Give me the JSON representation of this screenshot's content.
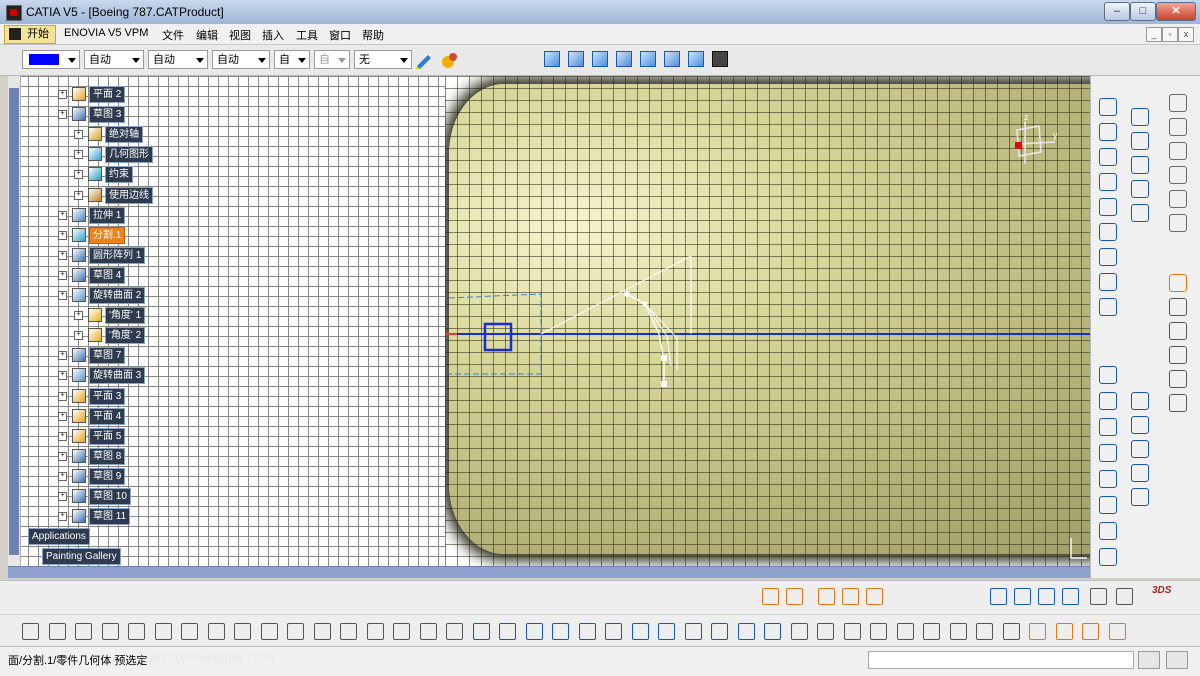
{
  "window": {
    "title": "CATIA V5 - [Boeing 787.CATProduct]"
  },
  "menu": {
    "start_label": "开始",
    "items": [
      {
        "id": "enovia",
        "label": "ENOVIA V5 VPM"
      },
      {
        "id": "file",
        "label": "文件"
      },
      {
        "id": "edit",
        "label": "编辑"
      },
      {
        "id": "view",
        "label": "视图"
      },
      {
        "id": "insert",
        "label": "插入"
      },
      {
        "id": "tools",
        "label": "工具"
      },
      {
        "id": "window",
        "label": "窗口"
      },
      {
        "id": "help",
        "label": "帮助"
      }
    ]
  },
  "graphic_props": {
    "color": "#0000ff",
    "combos": [
      "自动",
      "自动",
      "自动",
      "自动",
      "自动",
      "无"
    ],
    "combo_truncated": [
      "自动",
      "自动",
      "自动",
      "自动",
      "自",
      "自"
    ]
  },
  "tree": {
    "nodes": [
      {
        "label": "平面 2",
        "icon": "plane-icon",
        "level": 2,
        "selected": false
      },
      {
        "label": "草图 3",
        "icon": "sketch-icon",
        "level": 2,
        "selected": false
      },
      {
        "label": "绝对轴",
        "icon": "axis-system-icon",
        "level": 3,
        "selected": false
      },
      {
        "label": "几何图形",
        "icon": "geometry-icon",
        "level": 3,
        "selected": false
      },
      {
        "label": "约束",
        "icon": "constraint-icon",
        "level": 3,
        "selected": false
      },
      {
        "label": "使用边线",
        "icon": "use-edge-icon",
        "level": 3,
        "selected": false
      },
      {
        "label": "拉伸 1",
        "icon": "extrude-icon",
        "level": 2,
        "selected": false
      },
      {
        "label": "分割.1",
        "icon": "split-icon",
        "level": 2,
        "selected": true
      },
      {
        "label": "圆形阵列 1",
        "icon": "circular-pattern-icon",
        "level": 2,
        "selected": false
      },
      {
        "label": "草图 4",
        "icon": "sketch-icon",
        "level": 2,
        "selected": false
      },
      {
        "label": "旋转曲面 2",
        "icon": "revolve-surface-icon",
        "level": 2,
        "selected": false
      },
      {
        "label": "'角度' 1",
        "icon": "parameter-icon",
        "level": 3,
        "selected": false
      },
      {
        "label": "'角度' 2",
        "icon": "parameter-icon",
        "level": 3,
        "selected": false
      },
      {
        "label": "草图 7",
        "icon": "sketch-icon",
        "level": 2,
        "selected": false
      },
      {
        "label": "旋转曲面 3",
        "icon": "revolve-surface-icon",
        "level": 2,
        "selected": false
      },
      {
        "label": "平面 3",
        "icon": "plane-icon",
        "level": 2,
        "selected": false
      },
      {
        "label": "平面 4",
        "icon": "plane-icon",
        "level": 2,
        "selected": false
      },
      {
        "label": "平面 5",
        "icon": "plane-icon",
        "level": 2,
        "selected": false
      },
      {
        "label": "草图 8",
        "icon": "sketch-icon",
        "level": 2,
        "selected": false
      },
      {
        "label": "草图 9",
        "icon": "sketch-icon",
        "level": 2,
        "selected": false
      },
      {
        "label": "草图 10",
        "icon": "sketch-icon",
        "level": 2,
        "selected": false
      },
      {
        "label": "草图 11",
        "icon": "sketch-icon",
        "level": 2,
        "selected": false
      }
    ],
    "applications_label": "Applications",
    "painting_gallery_label": "Painting Gallery"
  },
  "compass": {
    "x_label": "x",
    "y_label": "y",
    "z_label": "z"
  },
  "status": {
    "text": "面/分割.1/零件几何体 预选定",
    "watermark": "lessonowhatter.com"
  },
  "colors": {
    "selected": "#f08018",
    "tree_label_bg": "#2e3a4e",
    "sketch_line": "#1a2cd6"
  }
}
